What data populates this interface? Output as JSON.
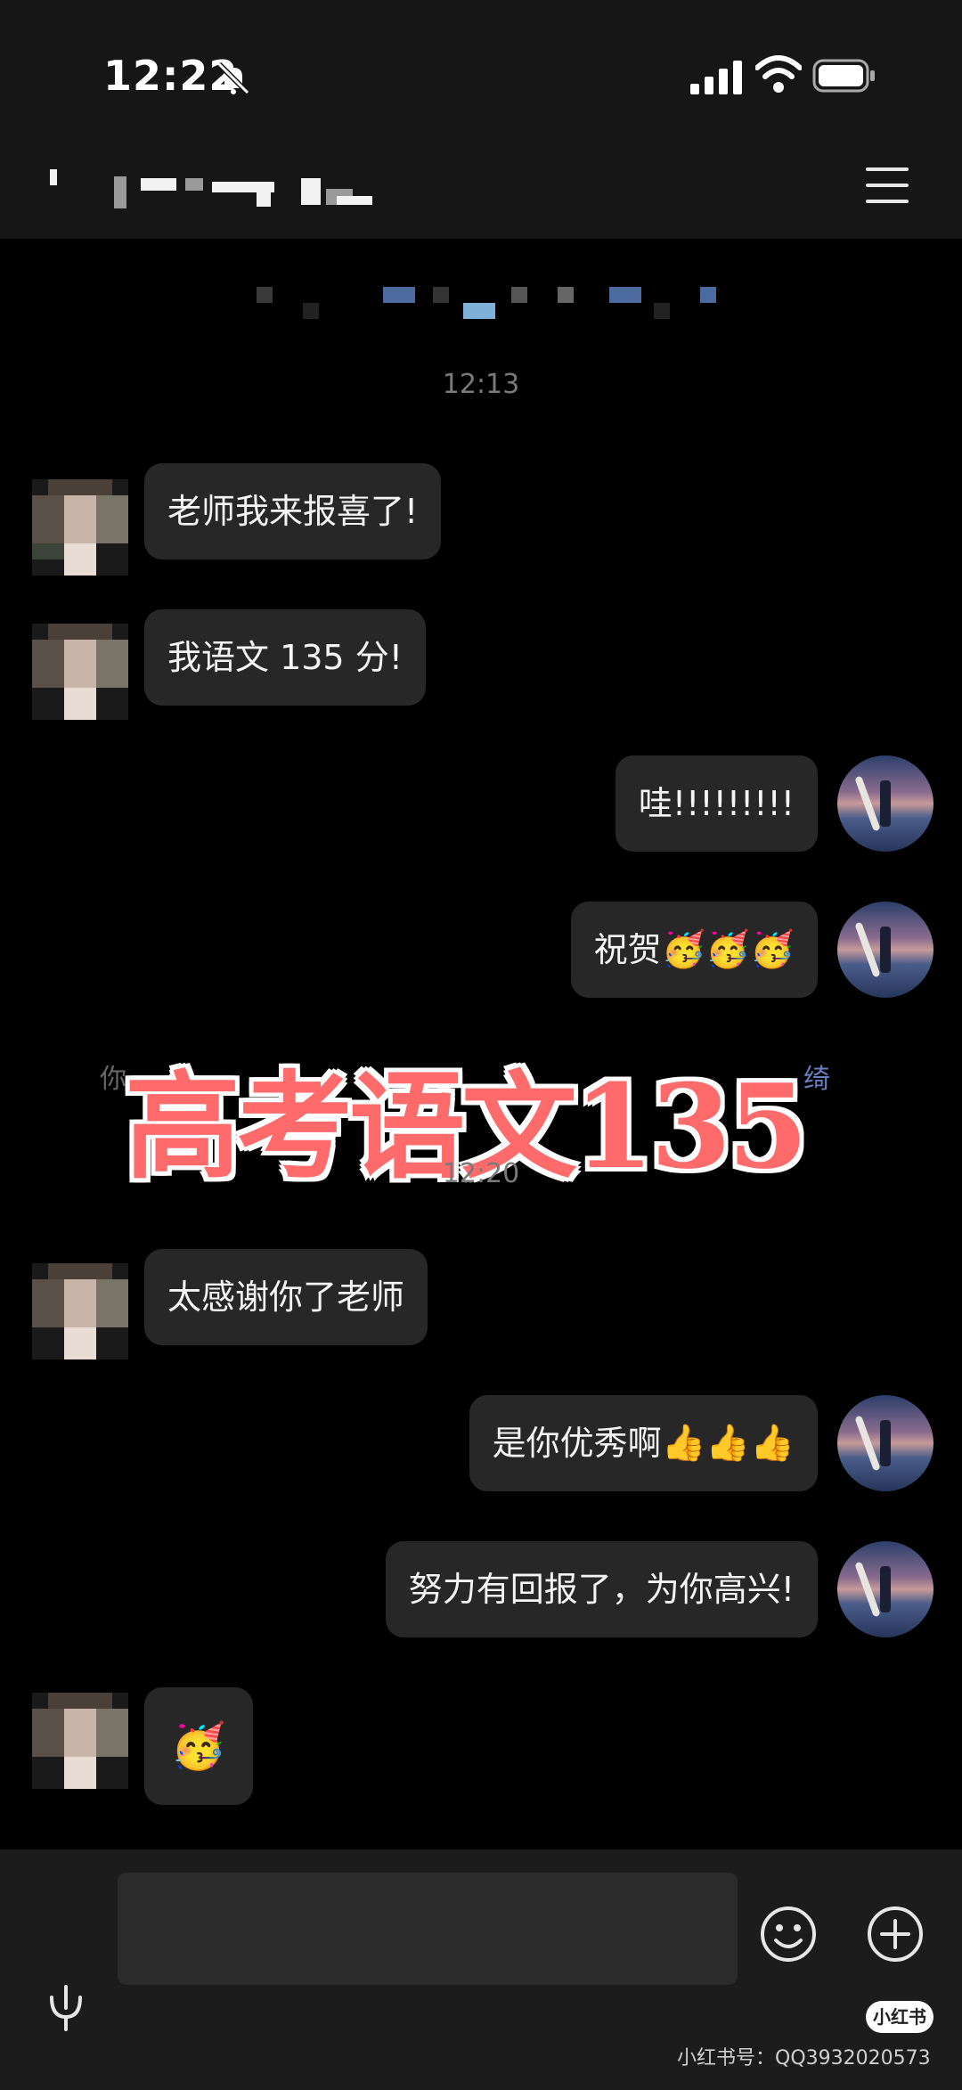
{
  "status_bar": {
    "time": "12:22"
  },
  "header": {
    "menu_icon": "hamburger-menu-icon"
  },
  "timestamps": [
    "12:13",
    "12:20"
  ],
  "messages": [
    {
      "side": "left",
      "text": "老师我来报喜了!"
    },
    {
      "side": "left",
      "text": "我语文 135 分!"
    },
    {
      "side": "right",
      "text": "哇!!!!!!!!!"
    },
    {
      "side": "right",
      "text": "祝贺",
      "emoji": "🥳🥳🥳"
    },
    {
      "side": "left",
      "text": "太感谢你了老师"
    },
    {
      "side": "right",
      "text": "是你优秀啊",
      "emoji": "👍👍👍"
    },
    {
      "side": "right",
      "text": "努力有回报了，为你高兴!"
    },
    {
      "side": "left",
      "text": "",
      "emoji": "🥳"
    }
  ],
  "recall_notice": {
    "prefix": "你",
    "highlight": "绮"
  },
  "overlay_title": "高考语文135",
  "input_bar": {
    "placeholder": "",
    "mic_icon": "microphone-icon",
    "emoji_icon": "smiley-icon",
    "plus_icon": "plus-icon"
  },
  "watermark": {
    "logo": "小红书",
    "text": "小红书号：QQ3932020573"
  },
  "colors": {
    "background": "#000000",
    "bubble": "#272727",
    "overlay": "#ff6a6a"
  }
}
